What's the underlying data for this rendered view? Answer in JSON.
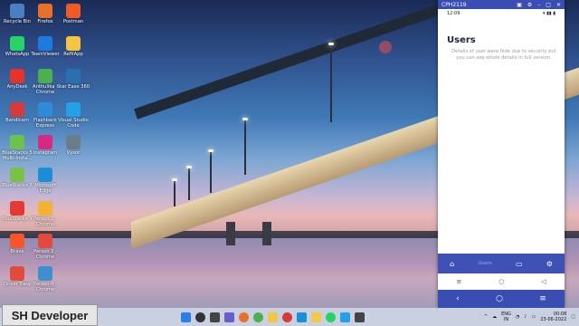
{
  "desktop": {
    "icons": [
      {
        "label": "Recycle Bin",
        "icon": "recycle-bin-icon",
        "color": "#4a7fc1"
      },
      {
        "label": "Firefox",
        "icon": "firefox-icon",
        "color": "#e8702a"
      },
      {
        "label": "Postman",
        "icon": "postman-icon",
        "color": "#ef5b25"
      },
      {
        "label": "WhatsApp",
        "icon": "whatsapp-icon",
        "color": "#25d366"
      },
      {
        "label": "TeamViewer",
        "icon": "teamviewer-icon",
        "color": "#1f7ae0"
      },
      {
        "label": "RefilApp",
        "icon": "refilapp-icon",
        "color": "#f4c542"
      },
      {
        "label": "AnyDesk",
        "icon": "anydesk-icon",
        "color": "#e5322d"
      },
      {
        "label": "Anthulika - Chrome",
        "icon": "chrome-icon",
        "color": "#4caf50"
      },
      {
        "label": "Star Ease 360",
        "icon": "starease-icon",
        "color": "#2a6fb0"
      },
      {
        "label": "Bandicam",
        "icon": "bandicam-icon",
        "color": "#d63a3a"
      },
      {
        "label": "Flashback Express",
        "icon": "flashback-icon",
        "color": "#2e8bd8"
      },
      {
        "label": "Visual Studio Code",
        "icon": "vscode-icon",
        "color": "#23a0e8"
      },
      {
        "label": "BlueStacks 5 Multi-Insta...",
        "icon": "bluestacks-icon",
        "color": "#6cc24a"
      },
      {
        "label": "Instagram",
        "icon": "instagram-icon",
        "color": "#d6297f"
      },
      {
        "label": "Vysor",
        "icon": "vysor-icon",
        "color": "#6b7d8c"
      },
      {
        "label": "BlueStacks 5",
        "icon": "bluestacks5-icon",
        "color": "#7cc242"
      },
      {
        "label": "Microsoft Edge",
        "icon": "edge-icon",
        "color": "#1a8fd6"
      },
      {
        "label": "BlueStacks X",
        "icon": "bluestacksx-icon",
        "color": "#e53935"
      },
      {
        "label": "Person 2 - Chrome",
        "icon": "chrome-person2-icon",
        "color": "#f2b233"
      },
      {
        "label": "Brave",
        "icon": "brave-icon",
        "color": "#fb542b"
      },
      {
        "label": "Person 3 - Chrome",
        "icon": "chrome-person3-icon",
        "color": "#e24a3b"
      },
      {
        "label": "Driver Easy",
        "icon": "drivereasy-icon",
        "color": "#e14b3c"
      },
      {
        "label": "Person 4 - Chrome",
        "icon": "chrome-person4-icon",
        "color": "#3e8ed0"
      }
    ]
  },
  "phone": {
    "window_title": "CPH2119",
    "status": {
      "time": "12:09"
    },
    "screen": {
      "heading": "Users",
      "message": "Details of user were hide due to security but you can see whole details in full version."
    },
    "bottom_nav": {
      "active_label": "Users"
    }
  },
  "watermark": {
    "text": "SH Developer"
  },
  "taskbar": {
    "tray": {
      "lang": "ENG",
      "region": "IN",
      "time": "00:08",
      "date": "23-06-2022"
    }
  },
  "colors": {
    "phone_accent": "#3f51b5",
    "taskbar": "#c9d1e0"
  }
}
